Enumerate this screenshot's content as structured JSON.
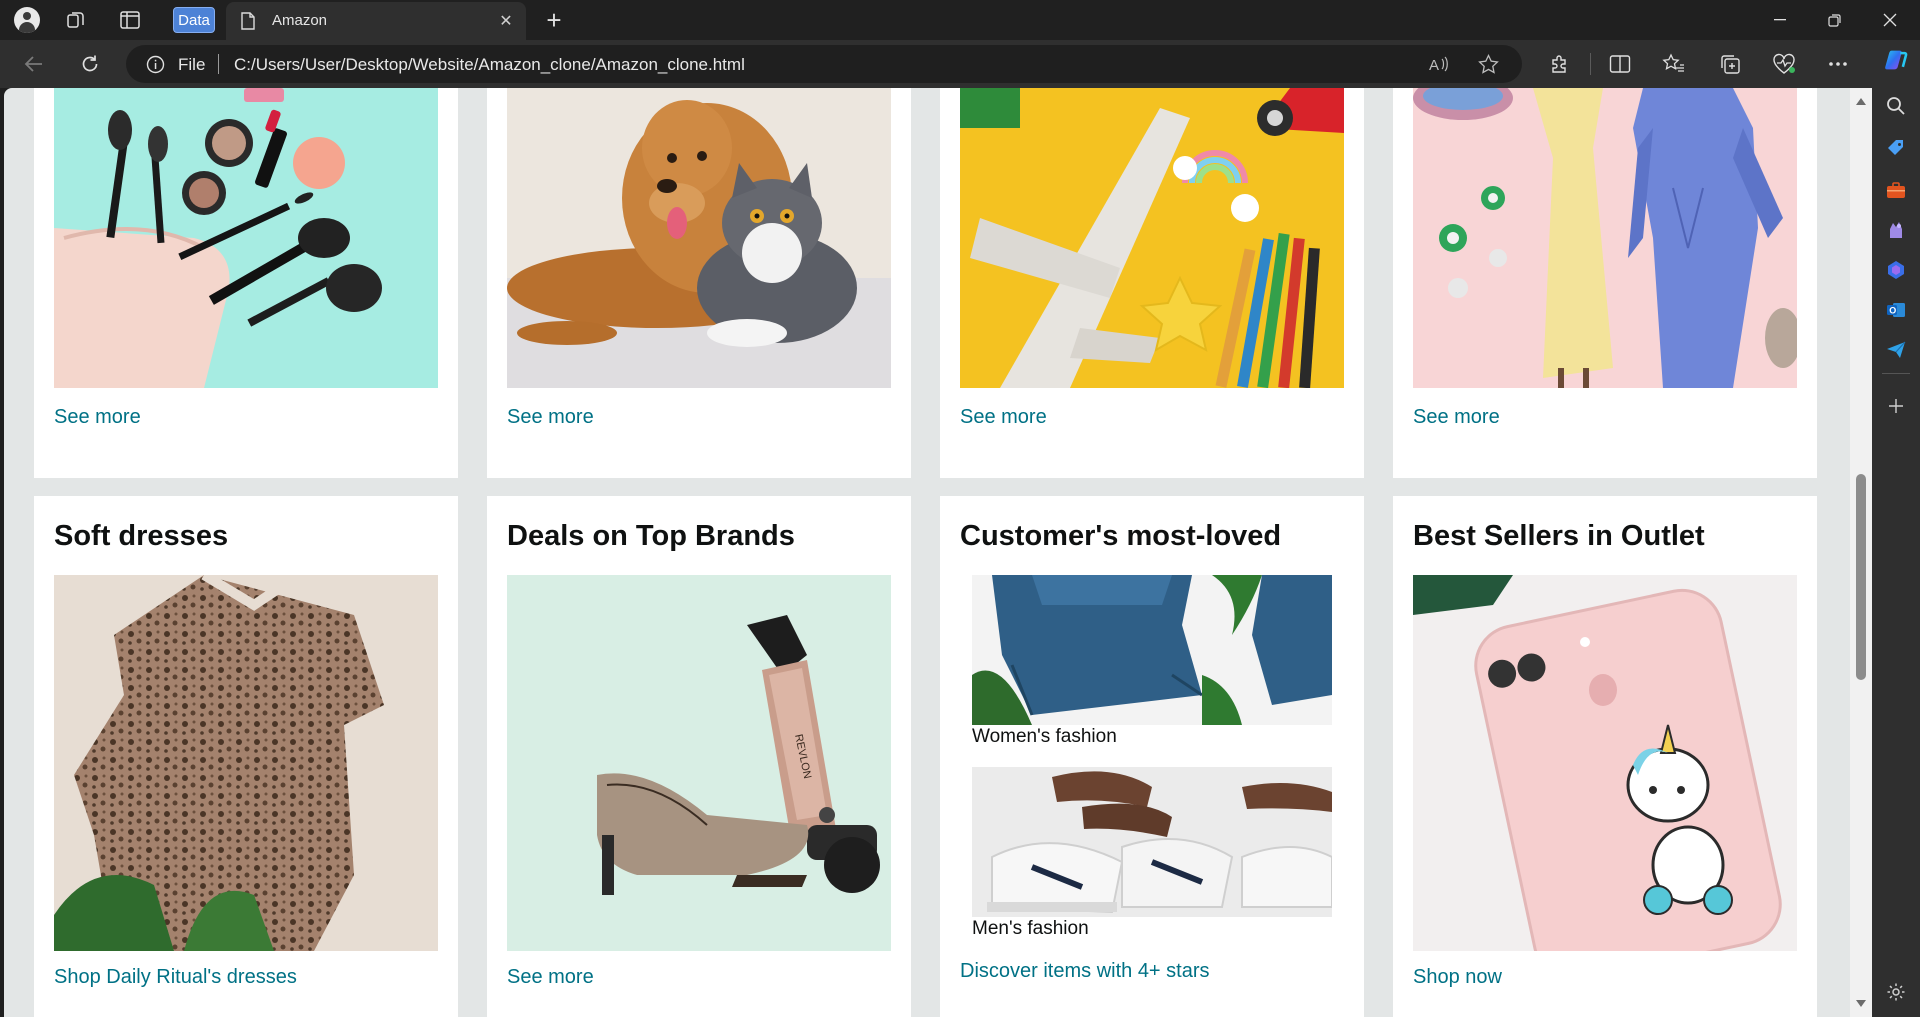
{
  "browser": {
    "workspace_label": "Data",
    "tab_title": "Amazon",
    "address_scheme_label": "File",
    "url": "C:/Users/User/Desktop/Website/Amazon_clone/Amazon_clone.html"
  },
  "top_row": [
    {
      "name": "beauty",
      "link": "See more"
    },
    {
      "name": "pets",
      "link": "See more"
    },
    {
      "name": "toys",
      "link": "See more"
    },
    {
      "name": "fashion",
      "link": "See more"
    }
  ],
  "cards": {
    "soft_dresses": {
      "title": "Soft dresses",
      "link": "Shop Daily Ritual's dresses"
    },
    "deals": {
      "title": "Deals on Top Brands",
      "link": "See more"
    },
    "most_loved": {
      "title": "Customer's most-loved",
      "items": [
        {
          "label": "Women's fashion"
        },
        {
          "label": "Men's fashion"
        }
      ],
      "link": "Discover items with 4+ stars"
    },
    "outlet": {
      "title": "Best Sellers in Outlet",
      "link": "Shop now"
    }
  },
  "icons": {
    "profile": "profile-icon",
    "workspaces": "workspaces-icon",
    "tab_actions": "vertical-tabs-icon",
    "page": "page-icon",
    "close": "close-icon",
    "new_tab": "plus-icon",
    "back": "back-arrow-icon",
    "refresh": "refresh-icon",
    "info": "info-icon",
    "read_aloud": "read-aloud-icon",
    "favorite": "star-icon",
    "extensions": "puzzle-icon",
    "split_screen": "split-screen-icon",
    "favorites": "favorites-icon",
    "collections": "collections-icon",
    "health": "browser-essentials-icon",
    "more": "more-icon",
    "copilot": "copilot-icon"
  },
  "colors": {
    "link": "#007185",
    "page_bg": "#e3e6e6",
    "card_bg": "#ffffff",
    "chrome_dark": "#202020",
    "workspace_badge": "#4d82d6"
  }
}
